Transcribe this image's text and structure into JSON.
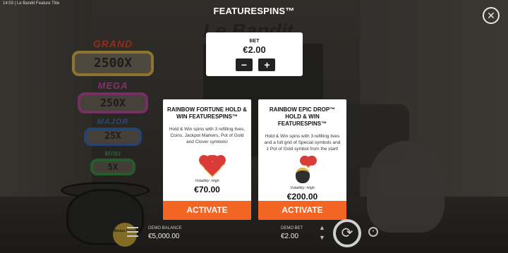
{
  "status_bar": {
    "text": "14:03 | Le Bandit Feature Title"
  },
  "header": {
    "title": "FEATURESPINS™",
    "close_icon": "close-icon"
  },
  "background": {
    "logo_text": "Le Bandit",
    "jackpots": [
      {
        "tier": "GRAND",
        "value": "2500X"
      },
      {
        "tier": "MEGA",
        "value": "250X"
      },
      {
        "tier": "MAJOR",
        "value": "25X"
      },
      {
        "tier": "MINI",
        "value": "5X"
      }
    ],
    "pot_badge": "Bonus Game"
  },
  "bet": {
    "label": "BET",
    "value": "€2.00",
    "minus": "−",
    "plus": "+"
  },
  "cards": [
    {
      "title": "RAINBOW FORTUNE HOLD & WIN FEATURESPINS™",
      "description": "Hold & Win spins with 3 refilling lives, Coins, Jackpot Markers, Pot of Gold and Clover symbols!",
      "icon": "hearts-icon",
      "volatility": "Volatility: High",
      "price": "€70.00",
      "button": "ACTIVATE"
    },
    {
      "title": "RAINBOW EPIC DROP™ HOLD & WIN FEATURESPINS™",
      "description": "Hold & Win spins with 3 refilling lives and a full grid of Special symbols and 1 Pot of Gold symbol from the start!",
      "icon": "pot-of-gold-icon",
      "volatility": "Volatility: High",
      "price": "€200.00",
      "button": "ACTIVATE"
    }
  ],
  "bottom_bar": {
    "demo_balance_label": "DEMO BALANCE",
    "demo_balance_value": "€5,000.00",
    "demo_bet_label": "DEMO BET",
    "demo_bet_value": "€2.00"
  },
  "colors": {
    "accent": "#f26522",
    "card_bg": "#ffffff"
  }
}
